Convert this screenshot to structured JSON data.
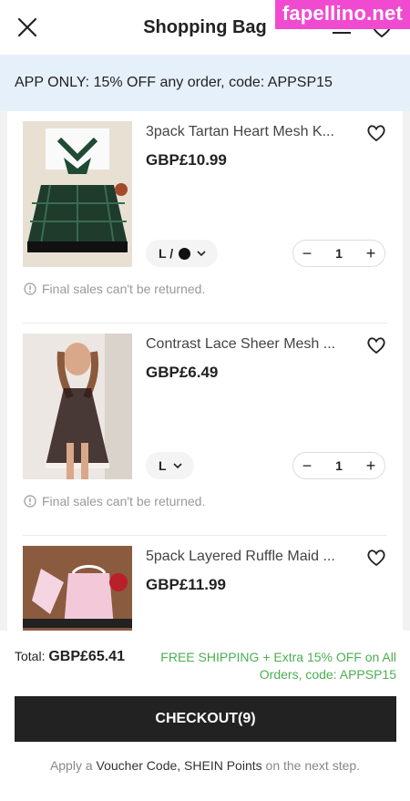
{
  "header": {
    "title": "Shopping Bag",
    "watermark": "fapellino.net"
  },
  "promo": {
    "text": "APP ONLY: 15% OFF any order, code: APPSP15"
  },
  "items": [
    {
      "name": "3pack Tartan Heart Mesh K...",
      "price": "GBP£10.99",
      "variant_size": "L /",
      "variant_color": "#111111",
      "qty": "1",
      "note": "Final sales can't be returned."
    },
    {
      "name": "Contrast Lace Sheer Mesh ...",
      "price": "GBP£6.49",
      "variant_size": "L",
      "qty": "1",
      "note": "Final sales can't be returned."
    },
    {
      "name": "5pack Layered Ruffle Maid ...",
      "price": "GBP£11.99"
    }
  ],
  "footer": {
    "total_label": "Total:",
    "total_value": "GBP£65.41",
    "shipping_line1": "FREE SHIPPING + Extra 15% OFF on All",
    "shipping_line2": "Orders, code: APPSP15",
    "checkout_label": "CHECKOUT(9)",
    "hint_pre": "Apply a",
    "hint_voucher": "Voucher Code,",
    "hint_points": "SHEIN Points",
    "hint_post": "on the next step."
  },
  "colors": {
    "promo_bg": "#e6f0fb",
    "shipping_green": "#4caf50",
    "checkout_bg": "#222222",
    "watermark_bg": "#f04bd0"
  }
}
